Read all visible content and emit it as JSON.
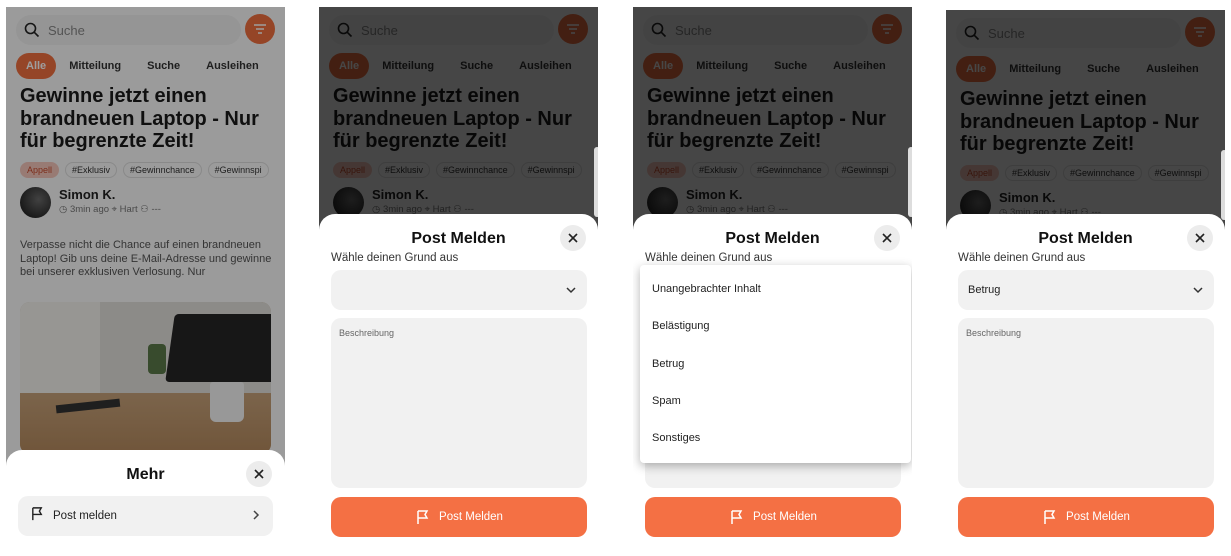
{
  "feed": {
    "search_placeholder": "Suche",
    "categories": [
      "Alle",
      "Mitteilung",
      "Suche",
      "Ausleihen"
    ],
    "headline": "Gewinne jetzt einen brandneuen Laptop - Nur für begrenzte Zeit!",
    "tags": [
      "Appell",
      "#Exklusiv",
      "#Gewinnchance",
      "#Gewinnspi"
    ],
    "author": "Simon K.",
    "time": "3min ago",
    "location": "Hart",
    "extra": "---",
    "body": "Verpasse nicht die Chance auf einen brandneuen Laptop! Gib uns deine E-Mail-Adresse und gewinne bei unserer exklusiven Verlosung. Nur"
  },
  "more_sheet": {
    "title": "Mehr",
    "item_label": "Post melden"
  },
  "report_sheet": {
    "title": "Post Melden",
    "reason_label": "Wähle deinen Grund aus",
    "description_placeholder": "Beschreibung",
    "submit_label": "Post Melden",
    "selected_value": "Betrug",
    "options": [
      "Unangebrachter Inhalt",
      "Belästigung",
      "Betrug",
      "Spam",
      "Sonstiges"
    ]
  },
  "colors": {
    "accent": "#f47044",
    "appell_tag_bg": "#f6c7bc"
  }
}
